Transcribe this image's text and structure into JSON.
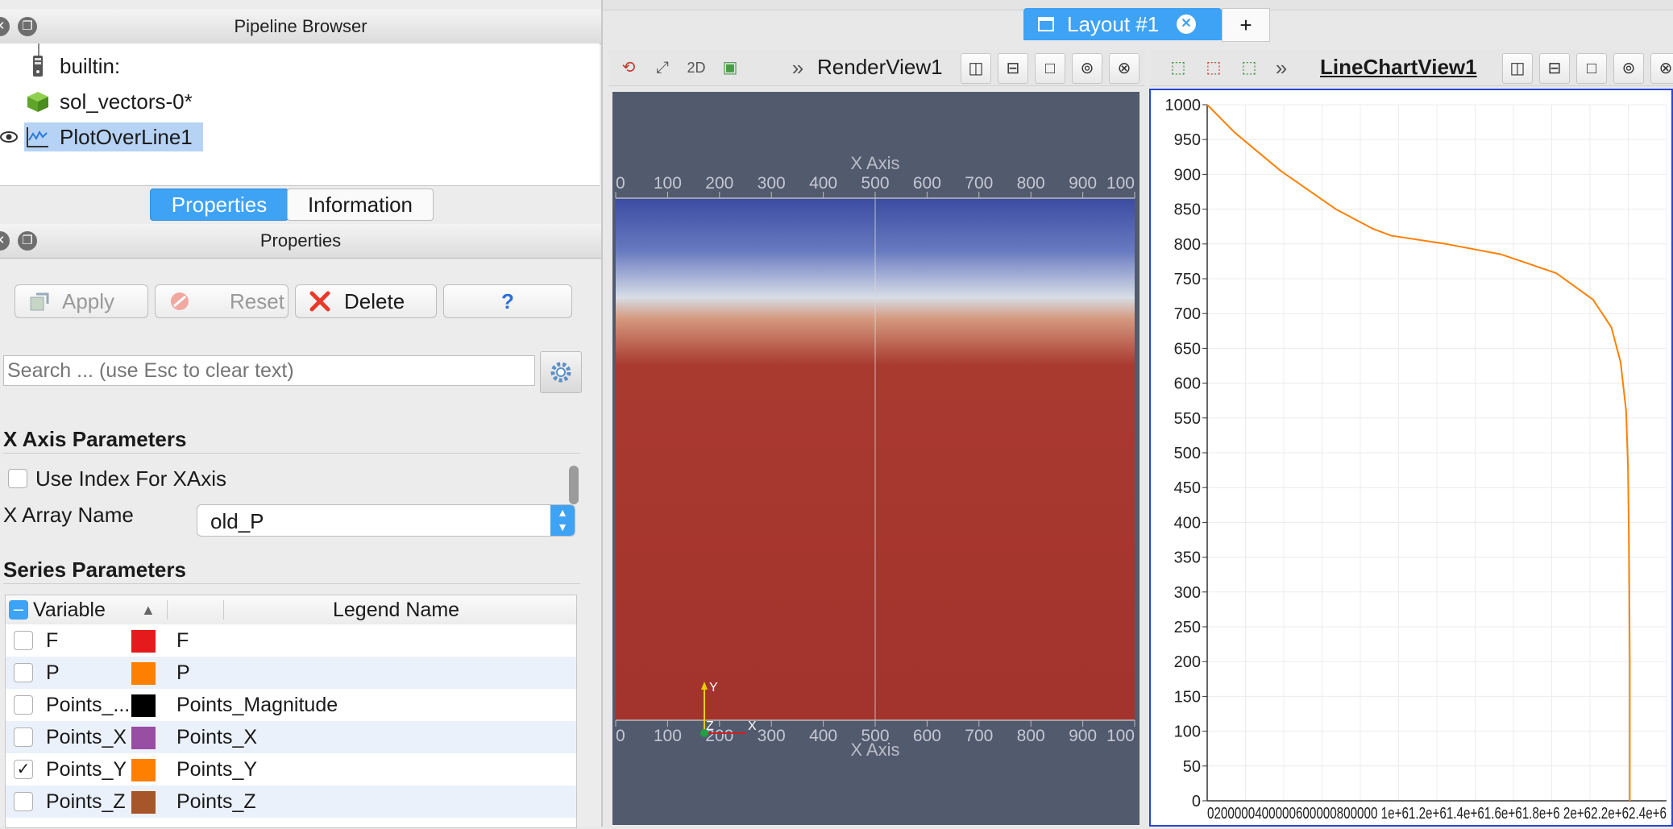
{
  "pipeline_browser": {
    "title": "Pipeline Browser",
    "items": [
      {
        "label": "builtin:",
        "icon": "server-icon"
      },
      {
        "label": "sol_vectors-0*",
        "icon": "cube-icon"
      },
      {
        "label": "PlotOverLine1",
        "icon": "line-plot-icon",
        "selected": true
      }
    ]
  },
  "tabs": {
    "properties": "Properties",
    "information": "Information",
    "active": "properties"
  },
  "properties_panel": {
    "title": "Properties",
    "buttons": {
      "apply": "Apply",
      "reset": "Reset",
      "delete": "Delete",
      "help": "?"
    },
    "search_placeholder": "Search ... (use Esc to clear text)",
    "x_axis_section": "X Axis Parameters",
    "use_index_label": "Use Index For XAxis",
    "use_index_checked": false,
    "x_array_label": "X Array Name",
    "x_array_value": "old_P",
    "series_section": "Series Parameters",
    "series_headers": {
      "variable": "Variable",
      "legend": "Legend Name"
    },
    "series": [
      {
        "variable": "F",
        "legend": "F",
        "color": "#e41a1c",
        "checked": false
      },
      {
        "variable": "P",
        "legend": "P",
        "color": "#ff7f00",
        "checked": false
      },
      {
        "variable": "Points_...",
        "legend": "Points_Magnitude",
        "color": "#000000",
        "checked": false
      },
      {
        "variable": "Points_X",
        "legend": "Points_X",
        "color": "#984ea3",
        "checked": false
      },
      {
        "variable": "Points_Y",
        "legend": "Points_Y",
        "color": "#ff7f00",
        "checked": true
      },
      {
        "variable": "Points_Z",
        "legend": "Points_Z",
        "color": "#a65628",
        "checked": false
      }
    ]
  },
  "layout": {
    "tab_label": "Layout #1",
    "add_tab": "+"
  },
  "render_view": {
    "title": "RenderView1",
    "mode_2d": "2D",
    "axis_title": "X Axis",
    "top_ticks": [
      "0",
      "100",
      "200",
      "300",
      "400",
      "500",
      "600",
      "700",
      "800",
      "900",
      "100"
    ],
    "bottom_ticks": [
      "0",
      "100",
      "200",
      "300",
      "400",
      "500",
      "600",
      "700",
      "800",
      "900",
      "100"
    ],
    "triad": {
      "y": "Y",
      "z": "Z",
      "x": "X"
    }
  },
  "line_chart_view": {
    "title": "LineChartView1"
  },
  "chart_data": {
    "type": "line",
    "y_ticks": [
      "1000",
      "950",
      "900",
      "850",
      "800",
      "750",
      "700",
      "650",
      "600",
      "550",
      "500",
      "450",
      "400",
      "350",
      "300",
      "250",
      "200",
      "150",
      "100",
      "50",
      "0"
    ],
    "x_tick_text": "0200000400000600000800000 1e+61.2e+61.4e+61.6e+61.8e+6 2e+62.2e+62.4e+6",
    "ylim": [
      0,
      1000
    ],
    "xlim": [
      0,
      2500000
    ],
    "grid": true,
    "series": [
      {
        "color": "#ff8000",
        "x": [
          0,
          150000,
          400000,
          700000,
          900000,
          1000000,
          1300000,
          1600000,
          1900000,
          2100000,
          2200000,
          2250000,
          2280000,
          2290000,
          2295000,
          2300000,
          2300000
        ],
        "y": [
          1000,
          960,
          905,
          850,
          822,
          812,
          800,
          785,
          758,
          720,
          680,
          630,
          560,
          480,
          380,
          200,
          0
        ]
      }
    ]
  }
}
